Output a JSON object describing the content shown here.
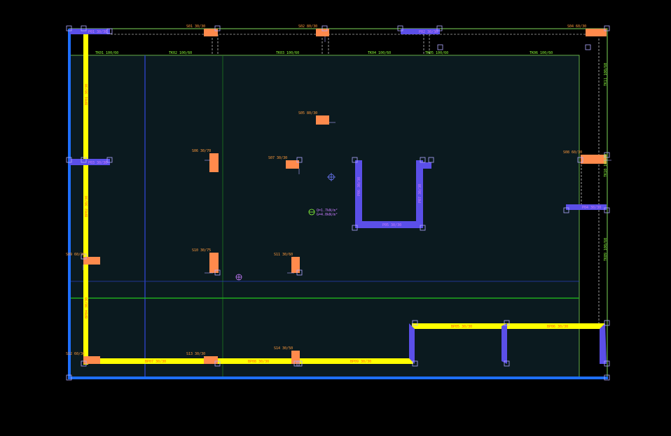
{
  "colors": {
    "background": "#000000",
    "slab": "#0b1a1f",
    "wall_blue": "#5b4fe8",
    "beam_yellow": "#ffff00",
    "column_orange": "#ff8a4c",
    "green_line": "#7ed957",
    "frame_blue": "#1e6fff",
    "label_orange": "#ff9a3c",
    "label_green": "#8dff3c",
    "label_purple": "#c87bff"
  },
  "columns": {
    "S01": "S01 30/30",
    "S02": "S02 80/30",
    "S04": "S04 60/30",
    "S05": "S05 80/30",
    "S06": "S06 30/70",
    "S07": "S07 30/30",
    "S08": "S08 60/30",
    "S09": "S09 60/30",
    "S10": "S10 30/75",
    "S11": "S11 30/60",
    "S12": "S12 60/30",
    "S13": "S13 30/30",
    "S14": "S14 30/50"
  },
  "top_beams": {
    "TK01": "TK01 100/60",
    "TK02": "TK02 100/60",
    "TK03": "TK03 100/60",
    "TK04": "TK04 100/60",
    "TK05": "TK05 100/60",
    "TK06": "TK06 100/60",
    "TK11": "TK11 100/60",
    "TK10": "TK10 100/60",
    "TK09": "TK09 100/60"
  },
  "foundation_beams": {
    "BP01": "BP01 30/30",
    "BP02": "BP02 30/30",
    "BP04": "BP04 30/30",
    "BP05": "BP05 30/30",
    "BP06": "BP06 30/30",
    "BP07": "BP07 30/30",
    "BP08": "BP08 30/30",
    "BP09": "BP09 30/30"
  },
  "walls": {
    "P01": "P01 30/30",
    "P02": "P02 30/30",
    "P03": "P03 30/30",
    "P04": "P04 30/30",
    "P05": "P05 30/30",
    "P06": "P06 30/30",
    "P07": "P07 30/30"
  },
  "slab_info": {
    "load_line1": "Q=1.7kN/m²",
    "load_line2": "G=4.0kN/m²"
  }
}
